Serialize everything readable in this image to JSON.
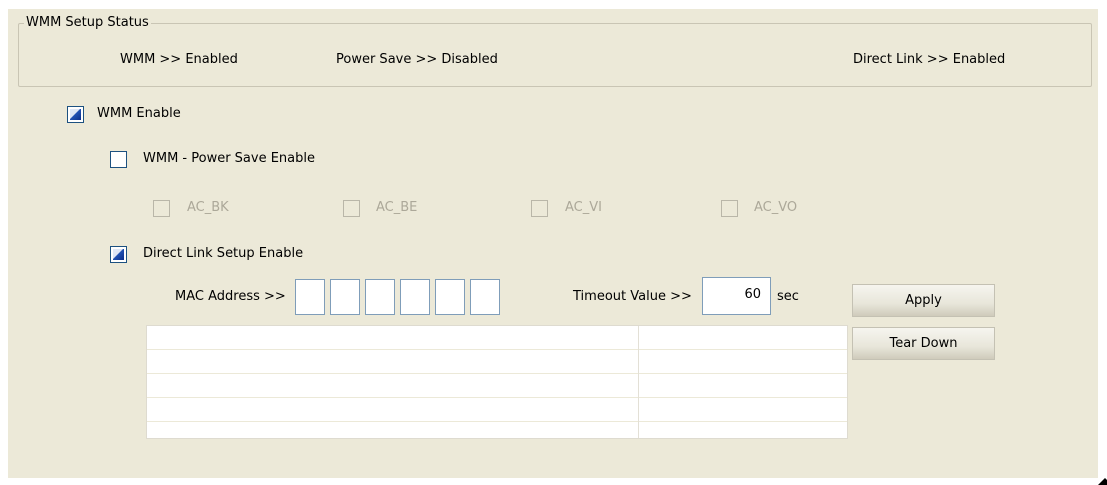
{
  "status": {
    "group_title": "WMM Setup Status",
    "wmm": "WMM >> Enabled",
    "power_save": "Power Save >> Disabled",
    "direct_link": "Direct Link >> Enabled"
  },
  "options": {
    "wmm_enable": {
      "label": "WMM Enable",
      "checked": true
    },
    "power_save_enable": {
      "label": "WMM - Power Save Enable",
      "checked": false
    },
    "ac": [
      {
        "label": "AC_BK",
        "checked": false,
        "disabled": true
      },
      {
        "label": "AC_BE",
        "checked": false,
        "disabled": true
      },
      {
        "label": "AC_VI",
        "checked": false,
        "disabled": true
      },
      {
        "label": "AC_VO",
        "checked": false,
        "disabled": true
      }
    ],
    "direct_link_enable": {
      "label": "Direct Link Setup Enable",
      "checked": true
    }
  },
  "dls": {
    "mac_label": "MAC Address >>",
    "mac_octets": [
      "",
      "",
      "",
      "",
      "",
      ""
    ],
    "timeout_label": "Timeout Value >>",
    "timeout_value": "60",
    "timeout_unit": "sec",
    "apply_label": "Apply",
    "teardown_label": "Tear Down",
    "table_rows": [
      [
        "",
        ""
      ],
      [
        "",
        ""
      ],
      [
        "",
        ""
      ],
      [
        "",
        ""
      ],
      [
        "",
        ""
      ]
    ]
  }
}
